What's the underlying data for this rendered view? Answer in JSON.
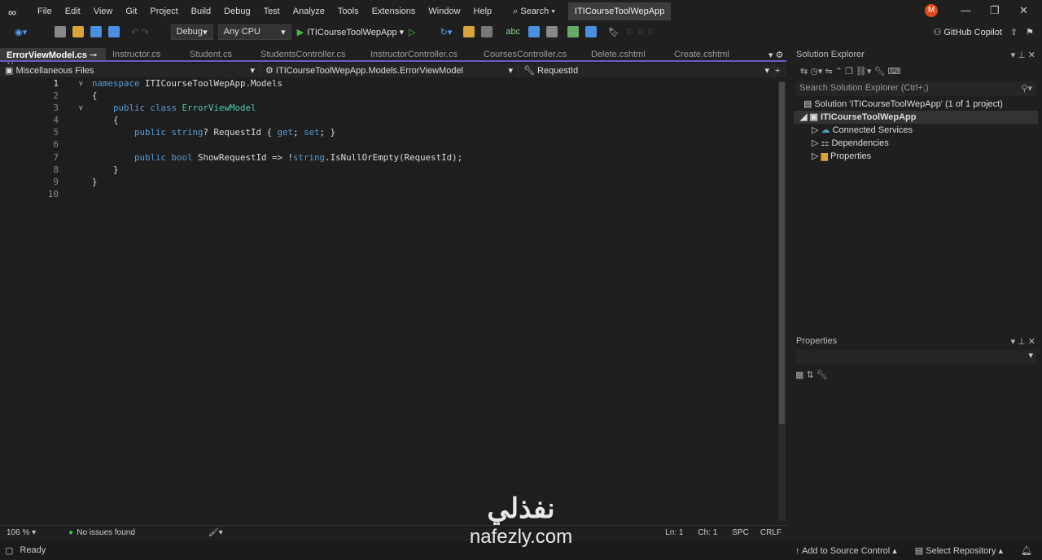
{
  "menu": [
    "File",
    "Edit",
    "View",
    "Git",
    "Project",
    "Build",
    "Debug",
    "Test",
    "Analyze",
    "Tools",
    "Extensions",
    "Window",
    "Help"
  ],
  "search_label": "Search",
  "app_title": "ITICourseToolWepApp",
  "avatar_initial": "M",
  "toolbar": {
    "config": "Debug",
    "platform": "Any CPU",
    "run_target": "ITICourseToolWepApp",
    "copilot": "GitHub Copilot"
  },
  "tabs": [
    "ErrorViewModel.cs",
    "Instructor.cs",
    "Student.cs",
    "StudentsController.cs",
    "InstructorController.cs",
    "CoursesController.cs",
    "Delete.cshtml",
    "Create.cshtml"
  ],
  "navbar": {
    "project": "Miscellaneous Files",
    "type": "ITICourseToolWepApp.Models.ErrorViewModel",
    "member": "RequestId"
  },
  "line_numbers": [
    "1",
    "2",
    "3",
    "4",
    "5",
    "6",
    "7",
    "8",
    "9",
    "10"
  ],
  "editor_status": {
    "zoom": "106 %",
    "issues": "No issues found",
    "ln": "Ln: 1",
    "ch": "Ch: 1",
    "spc": "SPC",
    "crlf": "CRLF"
  },
  "status": {
    "ready": "Ready",
    "source_control": "Add to Source Control",
    "repo": "Select Repository"
  },
  "solution_explorer": {
    "title": "Solution Explorer",
    "search_placeholder": "Search Solution Explorer (Ctrl+;)",
    "solution": "Solution 'ITICourseToolWepApp' (1 of 1 project)",
    "project": "ITICourseToolWepApp",
    "items": [
      "Connected Services",
      "Dependencies",
      "Properties"
    ]
  },
  "properties": {
    "title": "Properties"
  },
  "watermark": {
    "arabic": "نفذلي",
    "latin": "nafezly.com"
  }
}
